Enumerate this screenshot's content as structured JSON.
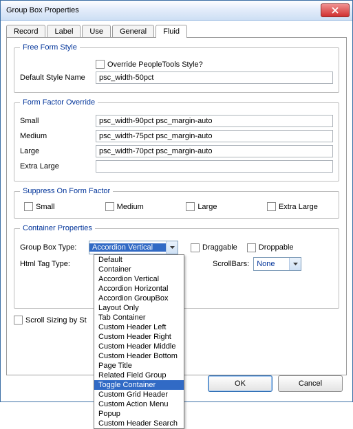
{
  "window": {
    "title": "Group Box Properties"
  },
  "tabs": {
    "t0": "Record",
    "t1": "Label",
    "t2": "Use",
    "t3": "General",
    "t4": "Fluid"
  },
  "freeform": {
    "legend": "Free Form Style",
    "override": "Override PeopleTools Style?",
    "defaultStyleLabel": "Default Style Name",
    "defaultStyleValue": "psc_width-50pct"
  },
  "form": {
    "legend": "Form Factor Override",
    "smallLbl": "Small",
    "smallVal": "psc_width-90pct psc_margin-auto",
    "mediumLbl": "Medium",
    "mediumVal": "psc_width-75pct psc_margin-auto",
    "largeLbl": "Large",
    "largeVal": "psc_width-70pct psc_margin-auto",
    "xlargeLbl": "Extra Large",
    "xlargeVal": ""
  },
  "suppress": {
    "legend": "Suppress On Form Factor",
    "s": "Small",
    "m": "Medium",
    "l": "Large",
    "xl": "Extra Large"
  },
  "container": {
    "legend": "Container Properties",
    "typeLbl": "Group Box Type:",
    "typeVal": "Accordion Vertical",
    "draggable": "Draggable",
    "droppable": "Droppable",
    "htmlTagLbl": "Html Tag Type:",
    "scrollbarsLbl": "ScrollBars:",
    "scrollbarsVal": "None",
    "listItems": {
      "i0": "Default",
      "i1": "Container",
      "i2": "Accordion Vertical",
      "i3": "Accordion Horizontal",
      "i4": "Accordion GroupBox",
      "i5": "Layout Only",
      "i6": "Tab Container",
      "i7": "Custom Header Left",
      "i8": "Custom Header Right",
      "i9": "Custom Header Middle",
      "i10": "Custom Header Bottom",
      "i11": "Page Title",
      "i12": "Related Field Group",
      "i13": "Toggle Container",
      "i14": "Custom Grid Header",
      "i15": "Custom Action Menu",
      "i16": "Popup",
      "i17": "Custom Header Search"
    }
  },
  "scrollSizing": "Scroll Sizing by St",
  "buttons": {
    "ok": "OK",
    "cancel": "Cancel"
  }
}
